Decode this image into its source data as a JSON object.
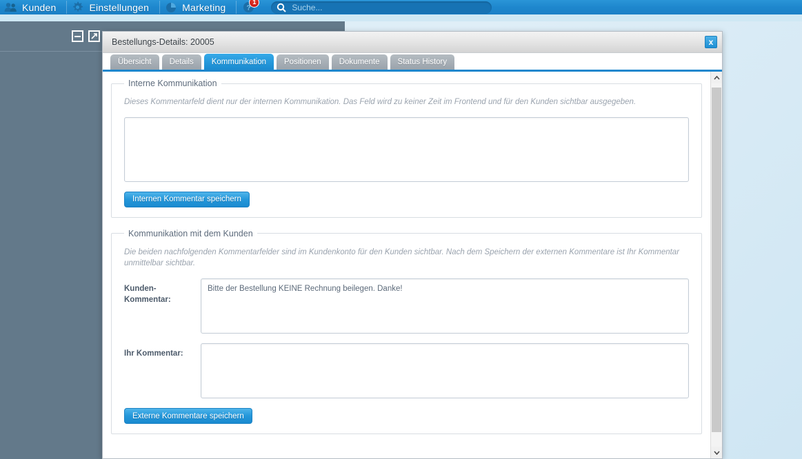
{
  "topnav": {
    "items": [
      {
        "label": "Kunden",
        "icon": "users-icon"
      },
      {
        "label": "Einstellungen",
        "icon": "gear-icon"
      },
      {
        "label": "Marketing",
        "icon": "pie-chart-icon"
      }
    ],
    "help": {
      "icon": "help-icon",
      "badge": "1"
    },
    "search": {
      "icon": "search-icon",
      "placeholder": "Suche...",
      "value": ""
    }
  },
  "background_panel": {
    "minimize_icon": "minimize-icon",
    "expand_icon": "expand-icon"
  },
  "modal": {
    "title": "Bestellungs-Details: 20005",
    "close_label": "x",
    "close_icon": "close-icon",
    "tabs": [
      {
        "label": "Übersicht",
        "active": false
      },
      {
        "label": "Details",
        "active": false
      },
      {
        "label": "Kommunikation",
        "active": true
      },
      {
        "label": "Positionen",
        "active": false
      },
      {
        "label": "Dokumente",
        "active": false
      },
      {
        "label": "Status History",
        "active": false
      }
    ],
    "internal": {
      "legend": "Interne Kommunikation",
      "note": "Dieses Kommentarfeld dient nur der internen Kommunikation. Das Feld wird zu keiner Zeit im Frontend und für den Kunden sichtbar ausgegeben.",
      "textarea_value": "",
      "textarea_placeholder": "",
      "save_button": "Internen Kommentar speichern"
    },
    "customer": {
      "legend": "Kommunikation mit dem Kunden",
      "note": "Die beiden nachfolgenden Kommentarfelder sind im Kundenkonto für den Kunden sichtbar. Nach dem Speichern der externen Kommentare ist Ihr Kommentar unmittelbar sichtbar.",
      "customer_comment_label": "Kunden-\nKommentar:",
      "customer_comment_value": "Bitte der Bestellung KEINE Rechnung beilegen. Danke!",
      "own_comment_label": "Ihr Kommentar:",
      "own_comment_value": "",
      "save_button": "Externe Kommentare speichern"
    },
    "scrollbar": {
      "up_icon": "chevron-up-icon",
      "down_icon": "chevron-down-icon"
    }
  },
  "colors": {
    "accent": "#1e87cd",
    "tab_active": "#2497da",
    "badge": "#c00d0d",
    "panel": "#63798a",
    "background": "#dceef6"
  }
}
